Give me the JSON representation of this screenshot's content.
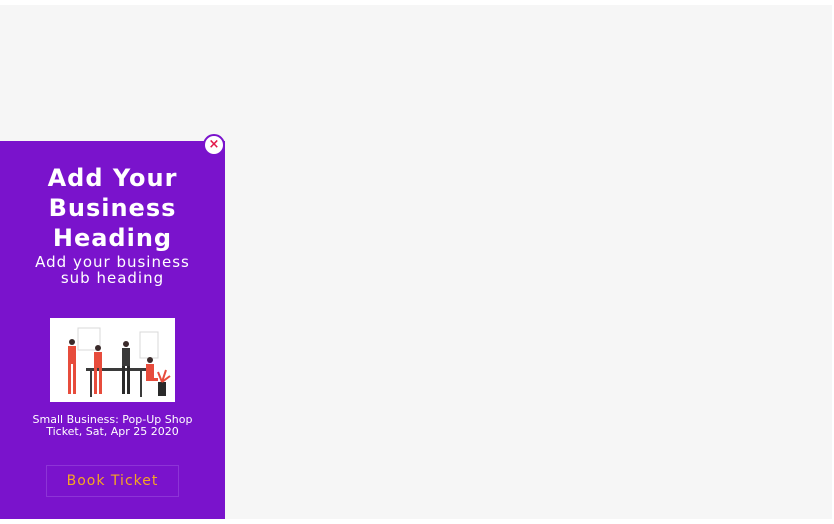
{
  "popup": {
    "close_symbol": "×",
    "heading": "Add Your Business Heading",
    "subheading": "Add your business sub heading",
    "image_icon": "team-illustration-icon",
    "event_text": "Small Business: Pop-Up Shop Ticket, Sat, Apr 25 2020",
    "button_label": "Book Ticket"
  },
  "colors": {
    "popup_bg": "#7a13cc",
    "button_text": "#f5a623",
    "close_icon": "#e3194a",
    "page_bg": "#f6f6f6"
  }
}
